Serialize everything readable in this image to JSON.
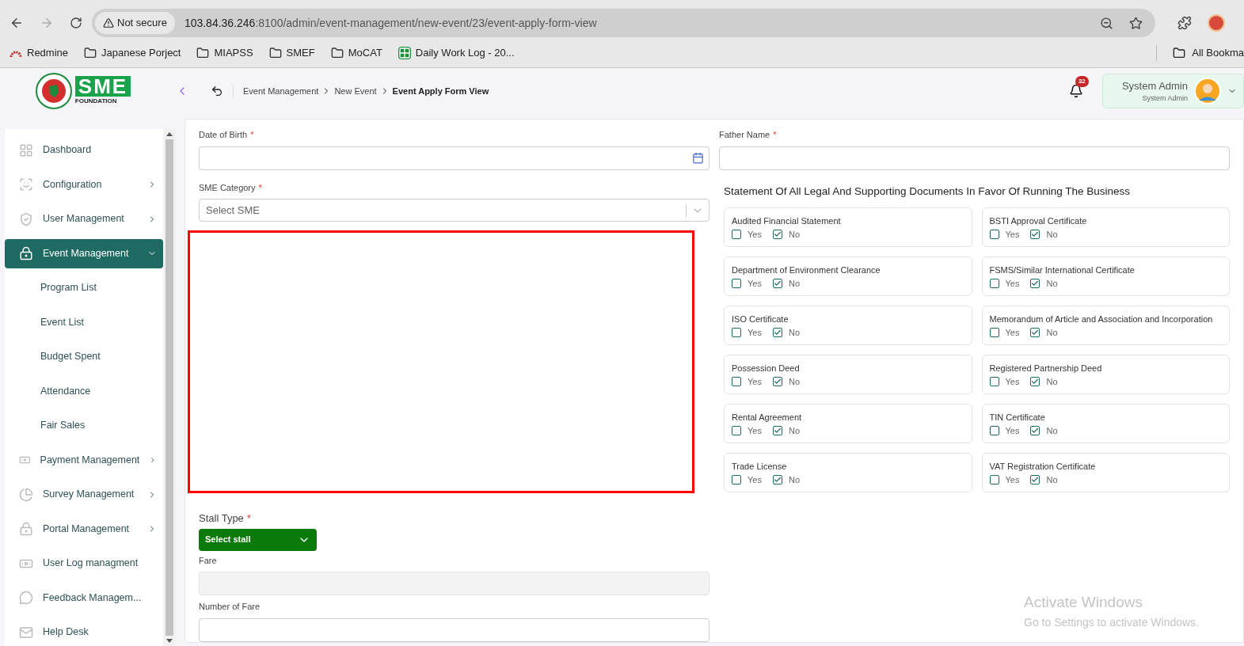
{
  "browser": {
    "security": "Not secure",
    "url_host": "103.84.36.246",
    "url_rest": ":8100/admin/event-management/new-event/23/event-apply-form-view",
    "bookmarks": [
      {
        "kind": "redmine",
        "label": "Redmine"
      },
      {
        "kind": "folder",
        "label": "Japanese Porject"
      },
      {
        "kind": "folder",
        "label": "MIAPSS"
      },
      {
        "kind": "folder",
        "label": "SMEF"
      },
      {
        "kind": "folder",
        "label": "MoCAT"
      },
      {
        "kind": "sheet",
        "label": "Daily Work Log - 20..."
      }
    ],
    "all_bookmarks": "All Bookma"
  },
  "logo": {
    "mark": "SME",
    "caption": "FOUNDATION"
  },
  "breadcrumb": [
    {
      "label": "Event Management",
      "current": false
    },
    {
      "label": "New Event",
      "current": false
    },
    {
      "label": "Event Apply Form View",
      "current": true
    }
  ],
  "notifications": {
    "count": "32"
  },
  "user": {
    "name": "System Admin",
    "role": "System Admin"
  },
  "sidebar": {
    "items": [
      {
        "kind": "grid",
        "label": "Dashboard",
        "expandable": false,
        "expanded": false,
        "selected": false
      },
      {
        "kind": "config",
        "label": "Configuration",
        "expandable": true,
        "expanded": false,
        "selected": false
      },
      {
        "kind": "shield",
        "label": "User Management",
        "expandable": true,
        "expanded": false,
        "selected": false
      },
      {
        "kind": "lock",
        "label": "Event Management",
        "expandable": true,
        "expanded": true,
        "selected": true,
        "children": [
          {
            "label": "Program List"
          },
          {
            "label": "Event List"
          },
          {
            "label": "Budget Spent"
          },
          {
            "label": "Attendance"
          },
          {
            "label": "Fair Sales"
          }
        ]
      },
      {
        "kind": "money",
        "label": "Payment Management",
        "expandable": true,
        "expanded": false,
        "selected": false
      },
      {
        "kind": "pie",
        "label": "Survey Management",
        "expandable": true,
        "expanded": false,
        "selected": false
      },
      {
        "kind": "lock",
        "label": "Portal Management",
        "expandable": true,
        "expanded": false,
        "selected": false
      },
      {
        "kind": "money",
        "label": "User Log managment",
        "expandable": false,
        "expanded": false,
        "selected": false
      },
      {
        "kind": "feedback",
        "label": "Feedback Managem...",
        "expandable": false,
        "expanded": false,
        "selected": false
      },
      {
        "kind": "mail",
        "label": "Help Desk",
        "expandable": false,
        "expanded": false,
        "selected": false
      }
    ]
  },
  "form": {
    "date_of_birth": {
      "label": "Date of Birth",
      "required_mark": "*"
    },
    "sme_category": {
      "label": "SME Category",
      "required_mark": "*",
      "placeholder": "Select SME"
    },
    "stall_type": {
      "label": "Stall Type",
      "required_mark": "*",
      "value": "Select stall"
    },
    "fare": {
      "label": "Fare",
      "disabled": true
    },
    "number_of_fare": {
      "label": "Number of Fare"
    },
    "father_name": {
      "label": "Father Name",
      "required_mark": "*"
    },
    "documents_title": "Statement Of All Legal And Supporting Documents In Favor Of Running The Business",
    "documents": [
      {
        "label": "Audited Financial Statement",
        "options": [
          {
            "label": "Yes",
            "checked": false
          },
          {
            "label": "No",
            "checked": true
          }
        ]
      },
      {
        "label": "BSTI Approval Certificate",
        "options": [
          {
            "label": "Yes",
            "checked": false
          },
          {
            "label": "No",
            "checked": true
          }
        ]
      },
      {
        "label": "Department of Environment Clearance",
        "options": [
          {
            "label": "Yes",
            "checked": false
          },
          {
            "label": "No",
            "checked": true
          }
        ]
      },
      {
        "label": "FSMS/Similar International Certificate",
        "options": [
          {
            "label": "Yes",
            "checked": false
          },
          {
            "label": "No",
            "checked": true
          }
        ]
      },
      {
        "label": "ISO Certificate",
        "options": [
          {
            "label": "Yes",
            "checked": false
          },
          {
            "label": "No",
            "checked": true
          }
        ]
      },
      {
        "label": "Memorandum of Article and Association and Incorporation",
        "options": [
          {
            "label": "Yes",
            "checked": false
          },
          {
            "label": "No",
            "checked": true
          }
        ]
      },
      {
        "label": "Possession Deed",
        "options": [
          {
            "label": "Yes",
            "checked": false
          },
          {
            "label": "No",
            "checked": true
          }
        ]
      },
      {
        "label": "Registered Partnership Deed",
        "options": [
          {
            "label": "Yes",
            "checked": false
          },
          {
            "label": "No",
            "checked": true
          }
        ]
      },
      {
        "label": "Rental Agreement",
        "options": [
          {
            "label": "Yes",
            "checked": false
          },
          {
            "label": "No",
            "checked": true
          }
        ]
      },
      {
        "label": "TIN Certificate",
        "options": [
          {
            "label": "Yes",
            "checked": false
          },
          {
            "label": "No",
            "checked": true
          }
        ]
      },
      {
        "label": "Trade License",
        "options": [
          {
            "label": "Yes",
            "checked": false
          },
          {
            "label": "No",
            "checked": true
          }
        ]
      },
      {
        "label": "VAT Registration Certificate",
        "options": [
          {
            "label": "Yes",
            "checked": false
          },
          {
            "label": "No",
            "checked": true
          }
        ]
      }
    ]
  },
  "os_notice": {
    "title": "Activate Windows",
    "subtitle": "Go to Settings to activate Windows."
  }
}
